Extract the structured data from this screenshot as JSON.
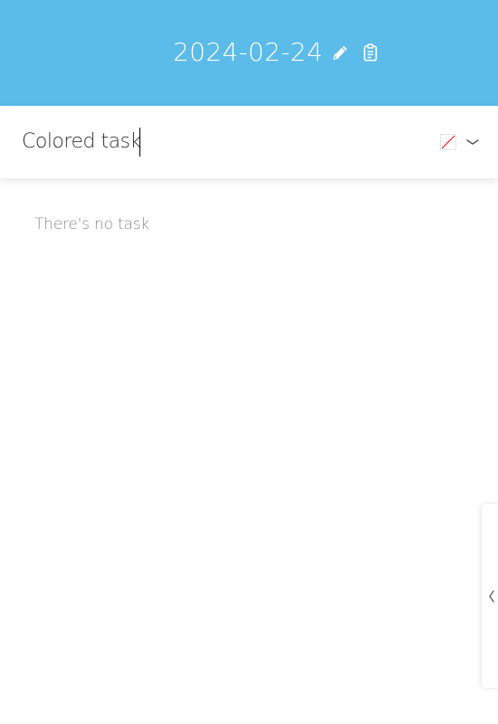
{
  "header": {
    "date": "2024-02-24",
    "background_color": "#5bbbe9",
    "icons": [
      "pencil-icon",
      "clipboard-icon"
    ]
  },
  "task_input": {
    "value": "Colored task",
    "color_swatch": "none",
    "dropdown_icon": "chevron-down-icon"
  },
  "task_list": {
    "empty_message": "There's no task"
  },
  "side_panel": {
    "toggle_icon": "chevron-left-icon"
  }
}
